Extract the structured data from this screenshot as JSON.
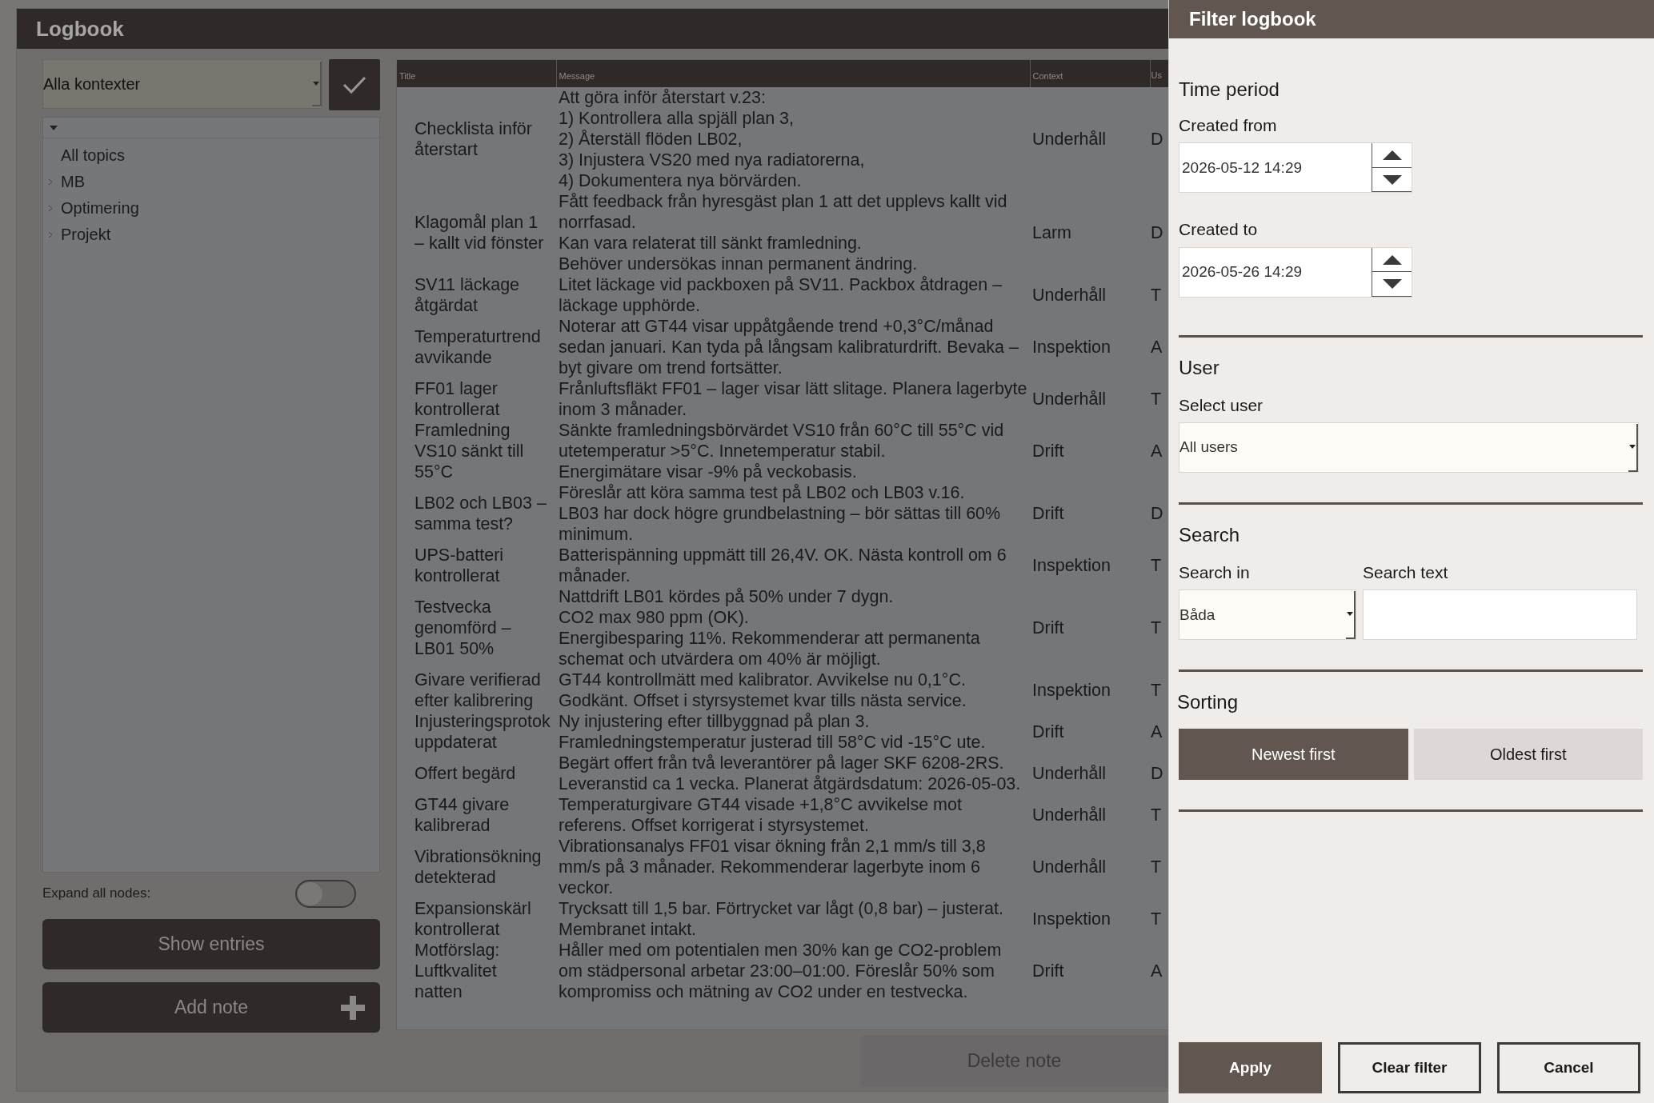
{
  "app": {
    "title": "Logbook",
    "context_select": {
      "value": "Alla kontexter"
    },
    "tree": {
      "items": [
        {
          "label": "All topics",
          "kind": "leaf"
        },
        {
          "label": "MB",
          "kind": "group"
        },
        {
          "label": "Optimering",
          "kind": "group"
        },
        {
          "label": "Projekt",
          "kind": "group"
        }
      ]
    },
    "expand_all": {
      "label": "Expand all nodes:",
      "on": false
    },
    "show_entries": "Show entries",
    "add_note": "Add note",
    "delete_note": "Delete note",
    "table": {
      "columns": [
        "Title",
        "Message",
        "Context",
        "Us"
      ],
      "rows": [
        {
          "title": "Checklista inför återstart",
          "message": "Att göra inför återstart v.23:\n1) Kontrollera alla spjäll plan 3,\n2) Återställ flöden LB02,\n3) Injustera VS20 med nya radiatorerna,\n4) Dokumentera nya börvärden.",
          "context": "Underhåll",
          "column_4": "D"
        },
        {
          "title": "Klagomål plan 1 – kallt vid fönster",
          "message": "Fått feedback från hyresgäst plan 1 att det upplevs kallt vid norrfasad.\nKan vara relaterat till sänkt framledning.\nBehöver undersökas innan permanent ändring.",
          "context": "Larm",
          "column_4": "D"
        },
        {
          "title": "SV11 läckage åtgärdat",
          "message": "Litet läckage vid packboxen på SV11. Packbox åtdragen – läckage upphörde.",
          "context": "Underhåll",
          "column_4": "T"
        },
        {
          "title": "Temperaturtrend avvikande",
          "message": "Noterar att GT44 visar uppåtgående trend +0,3°C/månad sedan januari. Kan tyda på långsam kalibraturdrift. Bevaka – byt givare om trend fortsätter.",
          "context": "Inspektion",
          "column_4": "A"
        },
        {
          "title": "FF01 lager kontrollerat",
          "message": "Frånluftsfläkt FF01 – lager visar lätt slitage. Planera lagerbyte inom 3 månader.",
          "context": "Underhåll",
          "column_4": "T"
        },
        {
          "title": "Framledning VS10 sänkt till 55°C",
          "message": "Sänkte framledningsbörvärdet VS10 från 60°C till 55°C vid utetemperatur >5°C. Innetemperatur stabil.\nEnergimätare visar -9% på veckobasis.",
          "context": "Drift",
          "column_4": "A"
        },
        {
          "title": "LB02 och LB03 – samma test?",
          "message": "Föreslår att köra samma test på LB02 och LB03 v.16.\nLB03 har dock högre grundbelastning – bör sättas till 60% minimum.",
          "context": "Drift",
          "column_4": "D"
        },
        {
          "title": "UPS-batteri kontrollerat",
          "message": "Batterispänning uppmätt till 26,4V. OK. Nästa kontroll om 6 månader.",
          "context": "Inspektion",
          "column_4": "T"
        },
        {
          "title": "Testvecka genomförd – LB01 50%",
          "message": "Nattdrift LB01 kördes på 50% under 7 dygn.\nCO2 max 980 ppm (OK).\nEnergibesparing 11%. Rekommenderar att permanenta schemat och utvärdera om 40% är möjligt.",
          "context": "Drift",
          "column_4": "T"
        },
        {
          "title": "Givare verifierad efter kalibrering",
          "message": "GT44 kontrollmätt med kalibrator. Avvikelse nu 0,1°C.\nGodkänt. Offset i styrsystemet kvar tills nästa service.",
          "context": "Inspektion",
          "column_4": "T"
        },
        {
          "title": "Injusteringsprotok uppdaterat",
          "message": "Ny injustering efter tillbyggnad på plan 3.\nFramledningstemperatur justerad till 58°C vid -15°C ute.",
          "context": "Drift",
          "column_4": "A"
        },
        {
          "title": "Offert begärd",
          "message": "Begärt offert från två leverantörer på lager SKF 6208-2RS.\nLeveranstid ca 1 vecka. Planerat åtgärdsdatum: 2026-05-03.",
          "context": "Underhåll",
          "column_4": "D"
        },
        {
          "title": "GT44 givare kalibrerad",
          "message": "Temperaturgivare GT44 visade +1,8°C avvikelse mot referens. Offset korrigerat i styrsystemet.",
          "context": "Underhåll",
          "column_4": "T"
        },
        {
          "title": "Vibrationsökning detekterad",
          "message": "Vibrationsanalys FF01 visar ökning från 2,1 mm/s till 3,8 mm/s på 3 månader. Rekommenderar lagerbyte inom 6 veckor.",
          "context": "Underhåll",
          "column_4": "T"
        },
        {
          "title": "Expansionskärl kontrollerat",
          "message": "Trycksatt till 1,5 bar. Förtrycket var lågt (0,8 bar) – justerat.\nMembranet intakt.",
          "context": "Inspektion",
          "column_4": "T"
        },
        {
          "title": "Motförslag: Luftkvalitet natten",
          "message": "Håller med om potentialen men 30% kan ge CO2-problem om städpersonal arbetar 23:00–01:00. Föreslår 50% som kompromiss och mätning av CO2 under en testvecka.",
          "context": "Drift",
          "column_4": "A"
        }
      ]
    }
  },
  "filter_panel": {
    "title": "Filter logbook",
    "time_period": {
      "heading": "Time period",
      "created_from": {
        "label": "Created from",
        "value": "2026-05-12 14:29"
      },
      "created_to": {
        "label": "Created to",
        "value": "2026-05-26 14:29"
      }
    },
    "user": {
      "heading": "User",
      "label": "Select user",
      "value": "All users"
    },
    "search": {
      "heading": "Search",
      "search_in": {
        "label": "Search in",
        "value": "Båda"
      },
      "search_text": {
        "label": "Search text"
      }
    },
    "sorting": {
      "heading": "Sorting",
      "options": [
        {
          "label": "Newest first",
          "selected": true
        },
        {
          "label": "Oldest first",
          "selected": false
        }
      ]
    },
    "buttons": [
      {
        "label": "Apply",
        "kind": "primary"
      },
      {
        "label": "Clear filter",
        "kind": "outline"
      },
      {
        "label": "Cancel",
        "kind": "outline"
      }
    ]
  }
}
